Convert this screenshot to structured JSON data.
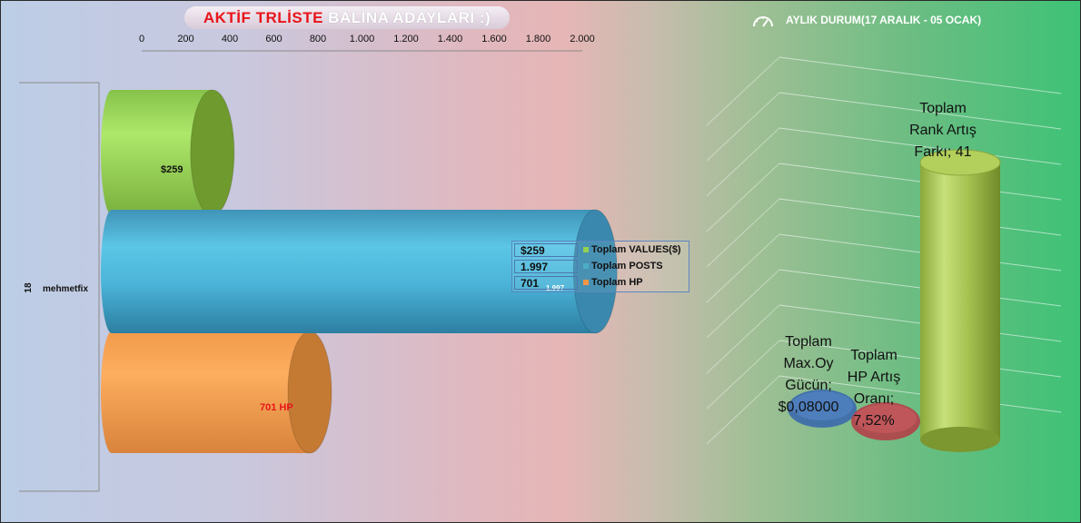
{
  "title": {
    "part1": "AKTİF TRLİSTE",
    "part2": "BALİNA  ADAYLARI  :)"
  },
  "left_chart": {
    "category": "mehmetfix",
    "rank": "18",
    "label_value": "$259",
    "label_posts": "1.997",
    "label_hp": "701 HP",
    "label_posts_small": "1.997"
  },
  "legend": {
    "items": [
      {
        "value": "$259",
        "label": "Toplam VALUES($)",
        "color": "#92d050"
      },
      {
        "value": "1.997",
        "label": "Toplam POSTS",
        "color": "#4bacc6"
      },
      {
        "value": "701",
        "label": "Toplam HP",
        "color": "#f79646"
      }
    ]
  },
  "right_chart": {
    "title": "AYLIK DURUM(17  ARALIK - 05 OCAK)",
    "icon": "gauge-icon",
    "label_voting": [
      "Toplam",
      "Max.Oy",
      "Gücün;",
      "$0,08000"
    ],
    "label_hp_rate": [
      "Toplam",
      "HP Artış",
      "Oranı;",
      "7,52%"
    ],
    "label_rank": [
      "Toplam",
      "Rank Artış",
      "Farkı; 41"
    ]
  },
  "chart_data": [
    {
      "type": "bar",
      "orientation": "horizontal",
      "title": "AKTİF TRLİSTE BALİNA ADAYLARI :)",
      "categories": [
        "mehmetfix"
      ],
      "series": [
        {
          "name": "Toplam VALUES($)",
          "values": [
            259
          ],
          "color": "#92d050"
        },
        {
          "name": "Toplam POSTS",
          "values": [
            1997
          ],
          "color": "#4bacc6"
        },
        {
          "name": "Toplam HP",
          "values": [
            701
          ],
          "color": "#f79646"
        }
      ],
      "xlim": [
        0,
        2000
      ],
      "ticks": [
        0,
        200,
        400,
        600,
        800,
        1000,
        1200,
        1400,
        1600,
        1800,
        2000
      ],
      "tick_labels": [
        "0",
        "200",
        "400",
        "600",
        "800",
        "1.000",
        "1.200",
        "1.400",
        "1.600",
        "1.800",
        "2.000"
      ],
      "legend": "right"
    },
    {
      "type": "bar",
      "title": "AYLIK DURUM(17  ARALIK - 05 OCAK)",
      "categories": [
        "Toplam Max.Oy Gücün",
        "Toplam HP Artış Oranı",
        "Toplam Rank Artış Farkı"
      ],
      "values": [
        0.08,
        7.52,
        41
      ],
      "colors": [
        "#4f81bd",
        "#c0504d",
        "#9bbb59"
      ]
    }
  ]
}
